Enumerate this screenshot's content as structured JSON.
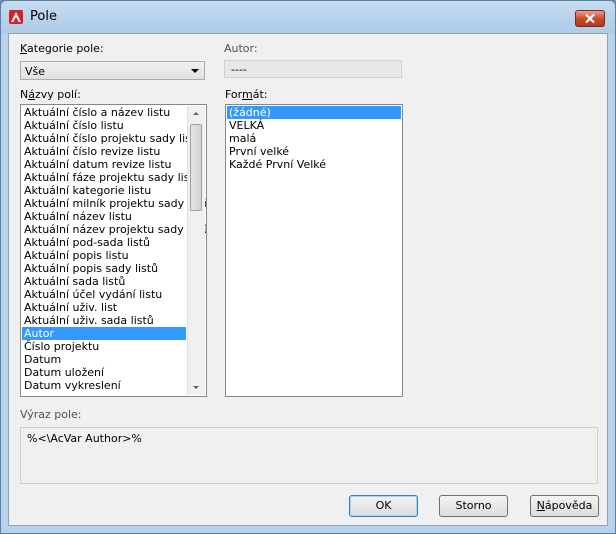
{
  "window": {
    "title": "Pole"
  },
  "category": {
    "label": "Kategorie pole:",
    "selected": "Vše"
  },
  "author": {
    "label": "Autor:",
    "value": "----"
  },
  "field_names": {
    "label": "Názvy polí:",
    "items": [
      "Aktuální číslo a název listu",
      "Aktuální číslo listu",
      "Aktuální číslo projektu sady listů",
      "Aktuální číslo revize listu",
      "Aktuální datum revize listu",
      "Aktuální fáze projektu sady listů",
      "Aktuální kategorie listu",
      "Aktuální milník projektu sady listů",
      "Aktuální název listu",
      "Aktuální název projektu sady listů",
      "Aktuální pod-sada listů",
      "Aktuální popis listu",
      "Aktuální popis sady listů",
      "Aktuální sada listů",
      "Aktuální účel vydání listu",
      "Aktuální uživ. list",
      "Aktuální uživ. sada listů",
      "Autor",
      "Číslo projektu",
      "Datum",
      "Datum uložení",
      "Datum vykreslení"
    ],
    "selected": "Autor"
  },
  "format": {
    "label": "Formát:",
    "items": [
      "(žádné)",
      "VELKÁ",
      "malá",
      "První velké",
      "Každé První Velké"
    ],
    "selected": "(žádné)"
  },
  "expression": {
    "label": "Výraz pole:",
    "value": "%<\\AcVar Author>%"
  },
  "buttons": {
    "ok": "OK",
    "cancel": "Storno",
    "help": "Nápověda"
  },
  "colors": {
    "selection": "#3399ff",
    "titlebar": "#b9d1ea",
    "close": "#c7462a"
  },
  "icons": {
    "app": "autocad-icon",
    "close": "close-icon"
  }
}
